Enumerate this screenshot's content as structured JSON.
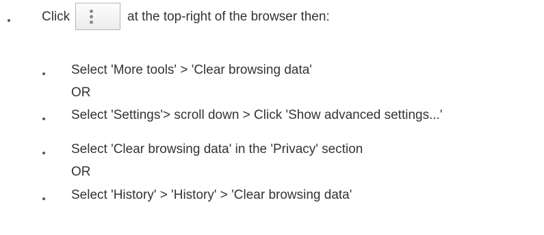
{
  "instructions": {
    "intro_before": "Click",
    "intro_after": "at the top-right of the browser then:",
    "menu_button_icon": "vertical-ellipsis-icon",
    "step_1": "Select 'More tools' > 'Clear browsing data'",
    "or_1": "OR",
    "step_2": "Select 'Settings'> scroll down > Click 'Show advanced settings...'",
    "step_3": "Select 'Clear browsing data' in the 'Privacy' section",
    "or_2": "OR",
    "step_4": "Select 'History' > 'History' > 'Clear browsing data'"
  }
}
